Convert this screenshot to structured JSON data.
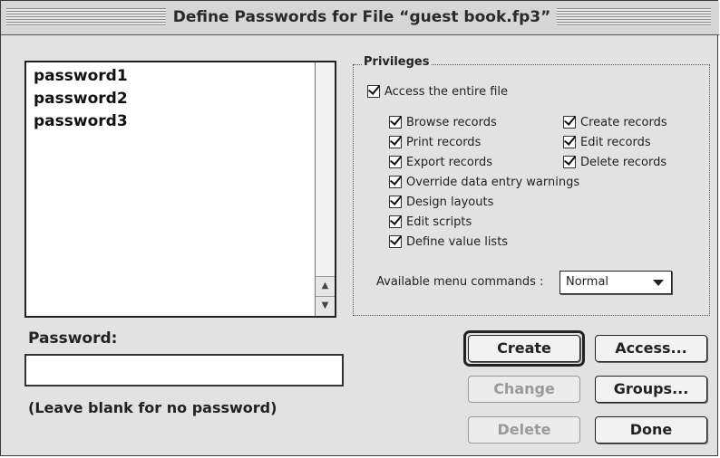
{
  "dialog": {
    "title": "Define Passwords for File “guest book.fp3”"
  },
  "passwords": [
    "password1",
    "password2",
    "password3"
  ],
  "scrollbar": {
    "up_icon": "up-arrow-icon",
    "down_icon": "down-arrow-icon"
  },
  "privileges": {
    "label": "Privileges",
    "entire_file": {
      "label": "Access the entire file",
      "checked": true
    },
    "items_left": [
      {
        "label": "Browse records",
        "checked": true
      },
      {
        "label": "Print records",
        "checked": true
      },
      {
        "label": "Export records",
        "checked": true
      },
      {
        "label": "Override data entry warnings",
        "checked": true
      },
      {
        "label": "Design layouts",
        "checked": true
      },
      {
        "label": "Edit scripts",
        "checked": true
      },
      {
        "label": "Define value lists",
        "checked": true
      }
    ],
    "items_right": [
      {
        "label": "Create records",
        "checked": true
      },
      {
        "label": "Edit records",
        "checked": true
      },
      {
        "label": "Delete records",
        "checked": true
      }
    ],
    "menu_commands": {
      "label": "Available menu commands :",
      "value": "Normal"
    }
  },
  "password_field": {
    "label": "Password:",
    "value": "",
    "hint": "(Leave blank for no password)"
  },
  "buttons": {
    "create": "Create",
    "change": "Change",
    "delete": "Delete",
    "access": "Access...",
    "groups": "Groups...",
    "done": "Done"
  }
}
